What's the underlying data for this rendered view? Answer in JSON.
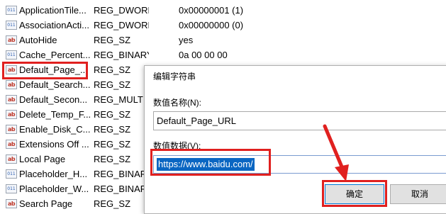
{
  "registry_values": [
    {
      "name": "ApplicationTile...",
      "type": "REG_DWORD",
      "data": "0x00000001 (1)",
      "icon": "dword-icon"
    },
    {
      "name": "AssociationActi...",
      "type": "REG_DWORD",
      "data": "0x00000000 (0)",
      "icon": "dword-icon"
    },
    {
      "name": "AutoHide",
      "type": "REG_SZ",
      "data": "yes",
      "icon": "string-icon"
    },
    {
      "name": "Cache_Percent...",
      "type": "REG_BINARY",
      "data": "0a 00 00 00",
      "icon": "binary-icon"
    },
    {
      "name": "Default_Page_...",
      "type": "REG_SZ",
      "data": "",
      "icon": "string-icon"
    },
    {
      "name": "Default_Search...",
      "type": "REG_SZ",
      "data": "",
      "icon": "string-icon"
    },
    {
      "name": "Default_Secon...",
      "type": "REG_MULTI_...",
      "data": "",
      "icon": "string-icon"
    },
    {
      "name": "Delete_Temp_F...",
      "type": "REG_SZ",
      "data": "",
      "icon": "string-icon"
    },
    {
      "name": "Enable_Disk_C...",
      "type": "REG_SZ",
      "data": "",
      "icon": "string-icon"
    },
    {
      "name": "Extensions Off ...",
      "type": "REG_SZ",
      "data": "",
      "icon": "string-icon"
    },
    {
      "name": "Local Page",
      "type": "REG_SZ",
      "data": "",
      "icon": "string-icon"
    },
    {
      "name": "Placeholder_H...",
      "type": "REG_BINARY",
      "data": "",
      "icon": "binary-icon"
    },
    {
      "name": "Placeholder_W...",
      "type": "REG_BINARY",
      "data": "",
      "icon": "binary-icon"
    },
    {
      "name": "Search Page",
      "type": "REG_SZ",
      "data": "",
      "icon": "string-icon"
    }
  ],
  "icon_text": {
    "sz": "ab",
    "bin": "011"
  },
  "dialog": {
    "title": "编辑字符串",
    "name_label": "数值名称(N):",
    "name_value": "Default_Page_URL",
    "data_label": "数值数据(V):",
    "data_value": "https://www.baidu.com/",
    "ok_label": "确定",
    "cancel_label": "取消"
  },
  "colors": {
    "highlight": "#e0201f",
    "selection": "#0a66c2",
    "arrow": "#e0201f"
  }
}
